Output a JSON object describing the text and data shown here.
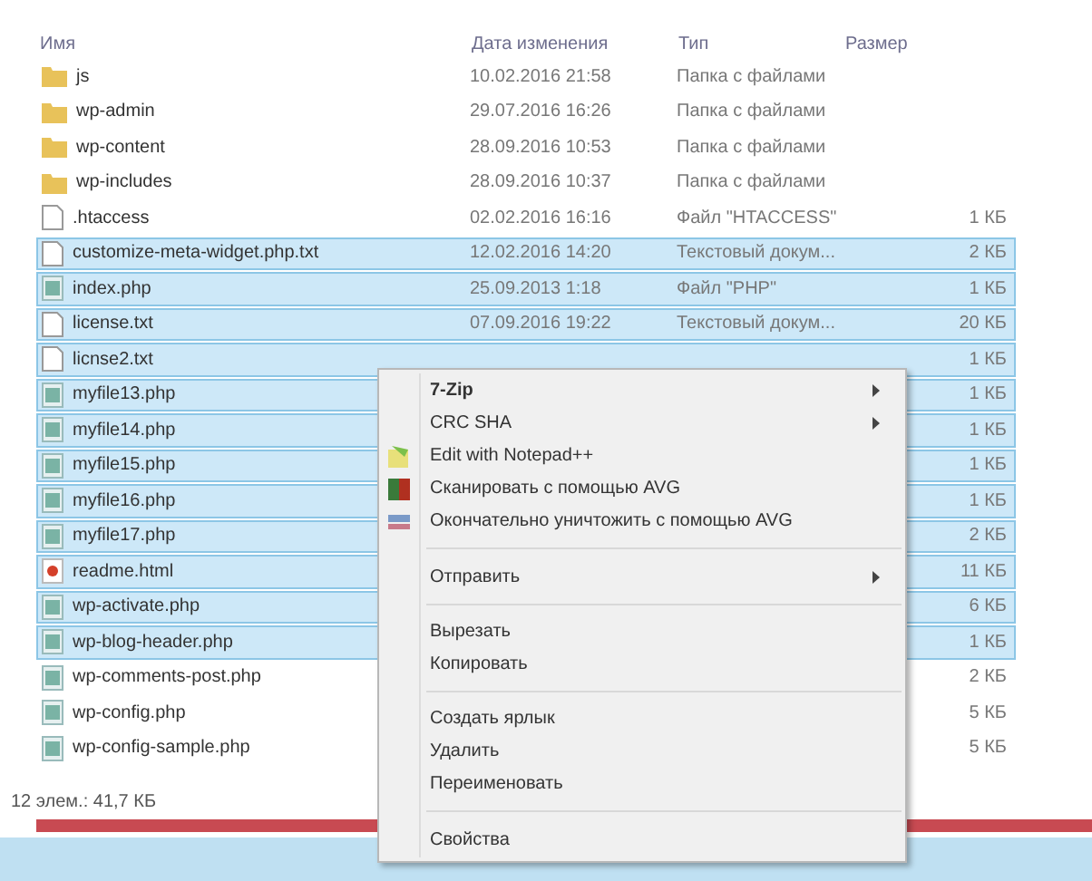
{
  "columns": [
    "Имя",
    "Дата изменения",
    "Тип",
    "Размер"
  ],
  "files": [
    {
      "kind": "folder",
      "name": "js",
      "date": "10.02.2016 21:58",
      "type": "Папка с файлами",
      "selected": false
    },
    {
      "kind": "folder",
      "name": "wp-admin",
      "date": "29.07.2016 16:26",
      "type": "Папка с файлами",
      "selected": false
    },
    {
      "kind": "folder",
      "name": "wp-content",
      "date": "28.09.2016 10:53",
      "type": "Папка с файлами",
      "selected": false
    },
    {
      "kind": "folder",
      "name": "wp-includes",
      "date": "28.09.2016 10:37",
      "type": "Папка с файлами",
      "selected": false
    },
    {
      "kind": "blank",
      "name": ".htaccess",
      "date": "02.02.2016 16:16",
      "type": "Файл \"HTACCESS\"",
      "size": "1 КБ",
      "selected": false
    },
    {
      "kind": "blank",
      "name": "customize-meta-widget.php.txt",
      "date": "12.02.2016 14:20",
      "type": "Текстовый докум...",
      "size": "2 КБ",
      "selected": true
    },
    {
      "kind": "php",
      "name": "index.php",
      "date": "25.09.2013 1:18",
      "type": "Файл \"PHP\"",
      "size": "1 КБ",
      "selected": true
    },
    {
      "kind": "blank",
      "name": "license.txt",
      "date": "07.09.2016 19:22",
      "type": "Текстовый докум...",
      "size": "20 КБ",
      "selected": true
    },
    {
      "kind": "blank",
      "name": "licnse2.txt",
      "size": "1 КБ",
      "selected": true
    },
    {
      "kind": "php",
      "name": "myfile13.php",
      "size": "1 КБ",
      "selected": true
    },
    {
      "kind": "php",
      "name": "myfile14.php",
      "size": "1 КБ",
      "selected": true
    },
    {
      "kind": "php",
      "name": "myfile15.php",
      "size": "1 КБ",
      "selected": true
    },
    {
      "kind": "php",
      "name": "myfile16.php",
      "size": "1 КБ",
      "selected": true
    },
    {
      "kind": "php",
      "name": "myfile17.php",
      "size": "2 КБ",
      "selected": true
    },
    {
      "kind": "html",
      "name": "readme.html",
      "size": "11 КБ",
      "selected": true
    },
    {
      "kind": "php",
      "name": "wp-activate.php",
      "size": "6 КБ",
      "selected": true
    },
    {
      "kind": "php",
      "name": "wp-blog-header.php",
      "size": "1 КБ",
      "selected": true
    },
    {
      "kind": "php",
      "name": "wp-comments-post.php",
      "size": "2 КБ",
      "selected": false
    },
    {
      "kind": "php",
      "name": "wp-config.php",
      "size": "5 КБ",
      "selected": false
    },
    {
      "kind": "php",
      "name": "wp-config-sample.php",
      "size": "5 КБ",
      "selected": false
    }
  ],
  "status_bar": "12 элем.: 41,7 КБ",
  "context_menu": [
    {
      "kind": "item",
      "label": "7-Zip",
      "bold": true,
      "submenu": true
    },
    {
      "kind": "item",
      "label": "CRC SHA",
      "submenu": true
    },
    {
      "kind": "app",
      "label": "Edit with Notepad++"
    },
    {
      "kind": "app",
      "label": "Сканировать с помощью AVG"
    },
    {
      "kind": "app",
      "label": "Окончательно уничтожить с помощью AVG"
    },
    {
      "kind": "separator"
    },
    {
      "kind": "item",
      "label": "Отправить",
      "submenu": true
    },
    {
      "kind": "separator"
    },
    {
      "kind": "item",
      "label": "Вырезать"
    },
    {
      "kind": "item",
      "label": "Копировать"
    },
    {
      "kind": "separator"
    },
    {
      "kind": "item",
      "label": "Создать ярлык"
    },
    {
      "kind": "item",
      "label": "Удалить"
    },
    {
      "kind": "item",
      "label": "Переименовать"
    },
    {
      "kind": "separator"
    },
    {
      "kind": "item",
      "label": "Свойства"
    }
  ]
}
